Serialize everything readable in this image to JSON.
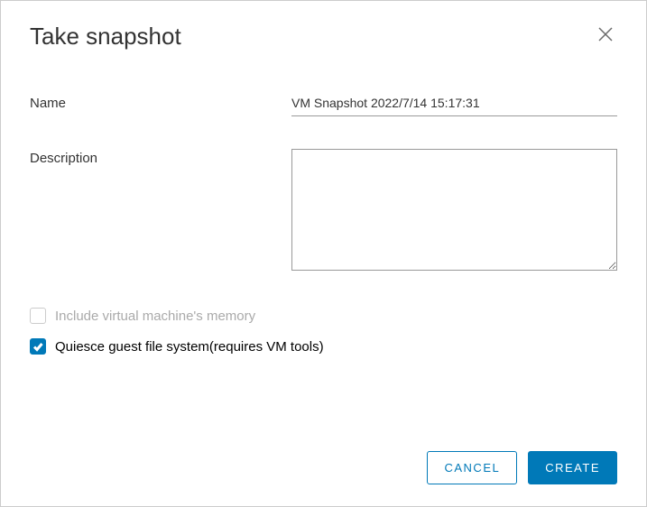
{
  "dialog": {
    "title": "Take snapshot"
  },
  "form": {
    "name_label": "Name",
    "name_value": "VM Snapshot 2022/7/14 15:17:31",
    "description_label": "Description",
    "description_value": ""
  },
  "checkboxes": {
    "include_memory_label": "Include virtual machine's memory",
    "quiesce_label": "Quiesce guest file system(requires VM tools)"
  },
  "buttons": {
    "cancel": "CANCEL",
    "create": "CREATE"
  }
}
